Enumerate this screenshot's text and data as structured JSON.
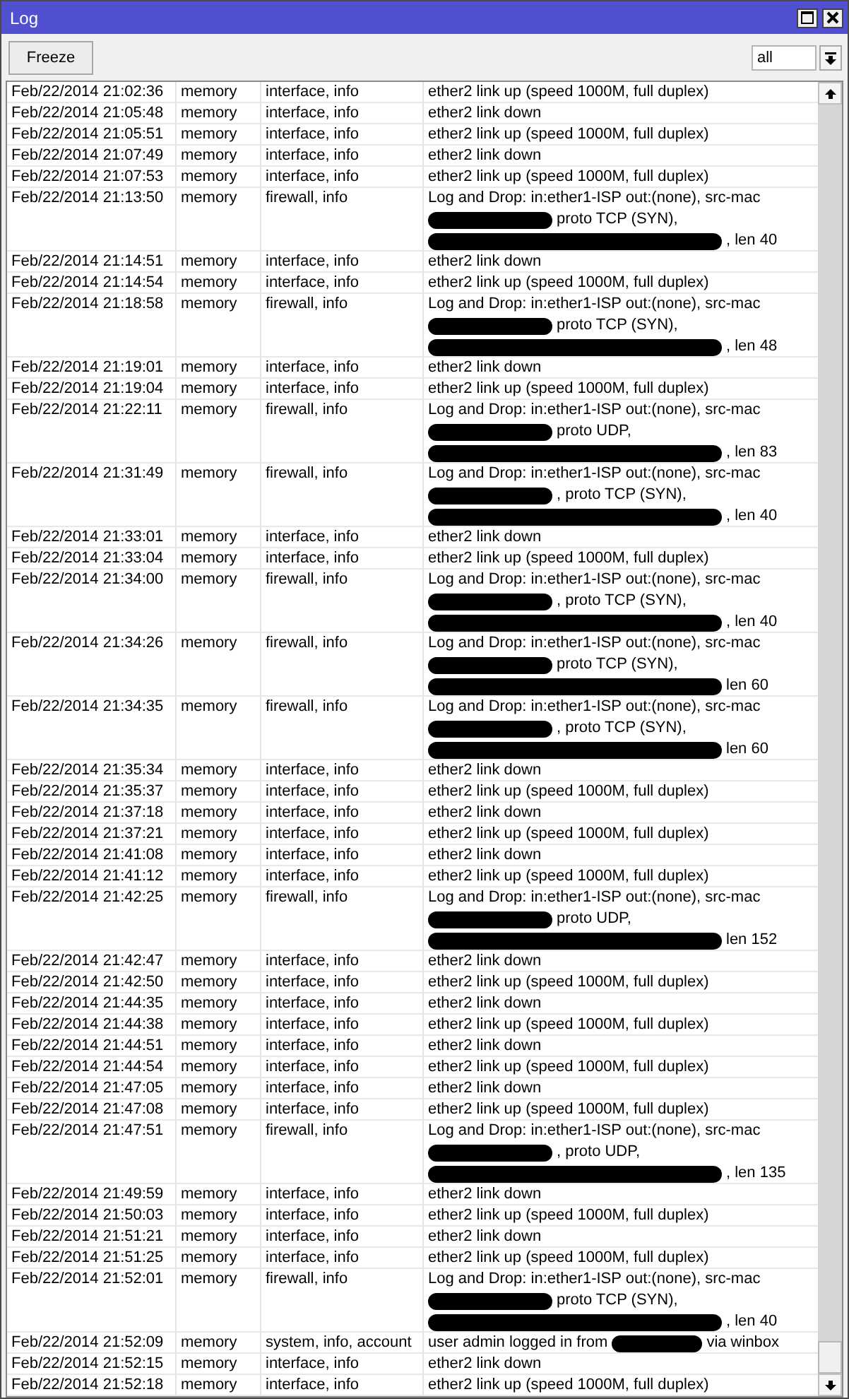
{
  "window": {
    "title": "Log"
  },
  "toolbar": {
    "freeze_button": "Freeze",
    "filter": {
      "value": "all"
    }
  },
  "log": {
    "rows": [
      {
        "column_1": "Feb/22/2014 21:02:36",
        "column_2": "memory",
        "column_3": "interface, info",
        "column_4": [
          [
            {
              "kind": "text",
              "text": "ether2 link up (speed 1000M, full duplex)"
            }
          ]
        ]
      },
      {
        "column_1": "Feb/22/2014 21:05:48",
        "column_2": "memory",
        "column_3": "interface, info",
        "column_4": [
          [
            {
              "kind": "text",
              "text": "ether2 link down"
            }
          ]
        ]
      },
      {
        "column_1": "Feb/22/2014 21:05:51",
        "column_2": "memory",
        "column_3": "interface, info",
        "column_4": [
          [
            {
              "kind": "text",
              "text": "ether2 link up (speed 1000M, full duplex)"
            }
          ]
        ]
      },
      {
        "column_1": "Feb/22/2014 21:07:49",
        "column_2": "memory",
        "column_3": "interface, info",
        "column_4": [
          [
            {
              "kind": "text",
              "text": "ether2 link down"
            }
          ]
        ]
      },
      {
        "column_1": "Feb/22/2014 21:07:53",
        "column_2": "memory",
        "column_3": "interface, info",
        "column_4": [
          [
            {
              "kind": "text",
              "text": "ether2 link up (speed 1000M, full duplex)"
            }
          ]
        ]
      },
      {
        "column_1": "Feb/22/2014 21:13:50",
        "column_2": "memory",
        "column_3": "firewall, info",
        "column_4": [
          [
            {
              "kind": "text",
              "text": "Log and Drop: in:ether1-ISP out:(none), src-mac"
            }
          ],
          [
            {
              "kind": "redaction"
            },
            {
              "kind": "text",
              "text": "proto TCP (SYN),"
            }
          ],
          [
            {
              "kind": "redaction"
            },
            {
              "kind": "text",
              "text": ", len 40"
            }
          ]
        ]
      },
      {
        "column_1": "Feb/22/2014 21:14:51",
        "column_2": "memory",
        "column_3": "interface, info",
        "column_4": [
          [
            {
              "kind": "text",
              "text": "ether2 link down"
            }
          ]
        ]
      },
      {
        "column_1": "Feb/22/2014 21:14:54",
        "column_2": "memory",
        "column_3": "interface, info",
        "column_4": [
          [
            {
              "kind": "text",
              "text": "ether2 link up (speed 1000M, full duplex)"
            }
          ]
        ]
      },
      {
        "column_1": "Feb/22/2014 21:18:58",
        "column_2": "memory",
        "column_3": "firewall, info",
        "column_4": [
          [
            {
              "kind": "text",
              "text": "Log and Drop: in:ether1-ISP out:(none), src-mac"
            }
          ],
          [
            {
              "kind": "redaction"
            },
            {
              "kind": "text",
              "text": "proto TCP (SYN),"
            }
          ],
          [
            {
              "kind": "redaction"
            },
            {
              "kind": "text",
              "text": ", len 48"
            }
          ]
        ]
      },
      {
        "column_1": "Feb/22/2014 21:19:01",
        "column_2": "memory",
        "column_3": "interface, info",
        "column_4": [
          [
            {
              "kind": "text",
              "text": "ether2 link down"
            }
          ]
        ]
      },
      {
        "column_1": "Feb/22/2014 21:19:04",
        "column_2": "memory",
        "column_3": "interface, info",
        "column_4": [
          [
            {
              "kind": "text",
              "text": "ether2 link up (speed 1000M, full duplex)"
            }
          ]
        ]
      },
      {
        "column_1": "Feb/22/2014 21:22:11",
        "column_2": "memory",
        "column_3": "firewall, info",
        "column_4": [
          [
            {
              "kind": "text",
              "text": "Log and Drop: in:ether1-ISP out:(none), src-mac"
            }
          ],
          [
            {
              "kind": "redaction"
            },
            {
              "kind": "text",
              "text": "proto UDP,"
            }
          ],
          [
            {
              "kind": "redaction"
            },
            {
              "kind": "text",
              "text": ", len 83"
            }
          ]
        ]
      },
      {
        "column_1": "Feb/22/2014 21:31:49",
        "column_2": "memory",
        "column_3": "firewall, info",
        "column_4": [
          [
            {
              "kind": "text",
              "text": "Log and Drop: in:ether1-ISP out:(none), src-mac"
            }
          ],
          [
            {
              "kind": "redaction"
            },
            {
              "kind": "text",
              "text": ", proto TCP (SYN),"
            }
          ],
          [
            {
              "kind": "redaction"
            },
            {
              "kind": "text",
              "text": ", len 40"
            }
          ]
        ]
      },
      {
        "column_1": "Feb/22/2014 21:33:01",
        "column_2": "memory",
        "column_3": "interface, info",
        "column_4": [
          [
            {
              "kind": "text",
              "text": "ether2 link down"
            }
          ]
        ]
      },
      {
        "column_1": "Feb/22/2014 21:33:04",
        "column_2": "memory",
        "column_3": "interface, info",
        "column_4": [
          [
            {
              "kind": "text",
              "text": "ether2 link up (speed 1000M, full duplex)"
            }
          ]
        ]
      },
      {
        "column_1": "Feb/22/2014 21:34:00",
        "column_2": "memory",
        "column_3": "firewall, info",
        "column_4": [
          [
            {
              "kind": "text",
              "text": "Log and Drop: in:ether1-ISP out:(none), src-mac"
            }
          ],
          [
            {
              "kind": "redaction"
            },
            {
              "kind": "text",
              "text": ", proto TCP (SYN),"
            }
          ],
          [
            {
              "kind": "redaction"
            },
            {
              "kind": "text",
              "text": ", len 40"
            }
          ]
        ]
      },
      {
        "column_1": "Feb/22/2014 21:34:26",
        "column_2": "memory",
        "column_3": "firewall, info",
        "column_4": [
          [
            {
              "kind": "text",
              "text": "Log and Drop: in:ether1-ISP out:(none), src-mac"
            }
          ],
          [
            {
              "kind": "redaction"
            },
            {
              "kind": "text",
              "text": "proto TCP (SYN),"
            }
          ],
          [
            {
              "kind": "redaction"
            },
            {
              "kind": "text",
              "text": "len 60"
            }
          ]
        ]
      },
      {
        "column_1": "Feb/22/2014 21:34:35",
        "column_2": "memory",
        "column_3": "firewall, info",
        "column_4": [
          [
            {
              "kind": "text",
              "text": "Log and Drop: in:ether1-ISP out:(none), src-mac"
            }
          ],
          [
            {
              "kind": "redaction"
            },
            {
              "kind": "text",
              "text": ", proto TCP (SYN),"
            }
          ],
          [
            {
              "kind": "redaction"
            },
            {
              "kind": "text",
              "text": "len 60"
            }
          ]
        ]
      },
      {
        "column_1": "Feb/22/2014 21:35:34",
        "column_2": "memory",
        "column_3": "interface, info",
        "column_4": [
          [
            {
              "kind": "text",
              "text": "ether2 link down"
            }
          ]
        ]
      },
      {
        "column_1": "Feb/22/2014 21:35:37",
        "column_2": "memory",
        "column_3": "interface, info",
        "column_4": [
          [
            {
              "kind": "text",
              "text": "ether2 link up (speed 1000M, full duplex)"
            }
          ]
        ]
      },
      {
        "column_1": "Feb/22/2014 21:37:18",
        "column_2": "memory",
        "column_3": "interface, info",
        "column_4": [
          [
            {
              "kind": "text",
              "text": "ether2 link down"
            }
          ]
        ]
      },
      {
        "column_1": "Feb/22/2014 21:37:21",
        "column_2": "memory",
        "column_3": "interface, info",
        "column_4": [
          [
            {
              "kind": "text",
              "text": "ether2 link up (speed 1000M, full duplex)"
            }
          ]
        ]
      },
      {
        "column_1": "Feb/22/2014 21:41:08",
        "column_2": "memory",
        "column_3": "interface, info",
        "column_4": [
          [
            {
              "kind": "text",
              "text": "ether2 link down"
            }
          ]
        ]
      },
      {
        "column_1": "Feb/22/2014 21:41:12",
        "column_2": "memory",
        "column_3": "interface, info",
        "column_4": [
          [
            {
              "kind": "text",
              "text": "ether2 link up (speed 1000M, full duplex)"
            }
          ]
        ]
      },
      {
        "column_1": "Feb/22/2014 21:42:25",
        "column_2": "memory",
        "column_3": "firewall, info",
        "column_4": [
          [
            {
              "kind": "text",
              "text": "Log and Drop: in:ether1-ISP out:(none), src-mac"
            }
          ],
          [
            {
              "kind": "redaction"
            },
            {
              "kind": "text",
              "text": "proto UDP,"
            }
          ],
          [
            {
              "kind": "redaction"
            },
            {
              "kind": "text",
              "text": "len 152"
            }
          ]
        ]
      },
      {
        "column_1": "Feb/22/2014 21:42:47",
        "column_2": "memory",
        "column_3": "interface, info",
        "column_4": [
          [
            {
              "kind": "text",
              "text": "ether2 link down"
            }
          ]
        ]
      },
      {
        "column_1": "Feb/22/2014 21:42:50",
        "column_2": "memory",
        "column_3": "interface, info",
        "column_4": [
          [
            {
              "kind": "text",
              "text": "ether2 link up (speed 1000M, full duplex)"
            }
          ]
        ]
      },
      {
        "column_1": "Feb/22/2014 21:44:35",
        "column_2": "memory",
        "column_3": "interface, info",
        "column_4": [
          [
            {
              "kind": "text",
              "text": "ether2 link down"
            }
          ]
        ]
      },
      {
        "column_1": "Feb/22/2014 21:44:38",
        "column_2": "memory",
        "column_3": "interface, info",
        "column_4": [
          [
            {
              "kind": "text",
              "text": "ether2 link up (speed 1000M, full duplex)"
            }
          ]
        ]
      },
      {
        "column_1": "Feb/22/2014 21:44:51",
        "column_2": "memory",
        "column_3": "interface, info",
        "column_4": [
          [
            {
              "kind": "text",
              "text": "ether2 link down"
            }
          ]
        ]
      },
      {
        "column_1": "Feb/22/2014 21:44:54",
        "column_2": "memory",
        "column_3": "interface, info",
        "column_4": [
          [
            {
              "kind": "text",
              "text": "ether2 link up (speed 1000M, full duplex)"
            }
          ]
        ]
      },
      {
        "column_1": "Feb/22/2014 21:47:05",
        "column_2": "memory",
        "column_3": "interface, info",
        "column_4": [
          [
            {
              "kind": "text",
              "text": "ether2 link down"
            }
          ]
        ]
      },
      {
        "column_1": "Feb/22/2014 21:47:08",
        "column_2": "memory",
        "column_3": "interface, info",
        "column_4": [
          [
            {
              "kind": "text",
              "text": "ether2 link up (speed 1000M, full duplex)"
            }
          ]
        ]
      },
      {
        "column_1": "Feb/22/2014 21:47:51",
        "column_2": "memory",
        "column_3": "firewall, info",
        "column_4": [
          [
            {
              "kind": "text",
              "text": "Log and Drop: in:ether1-ISP out:(none), src-mac"
            }
          ],
          [
            {
              "kind": "redaction"
            },
            {
              "kind": "text",
              "text": ", proto UDP,"
            }
          ],
          [
            {
              "kind": "redaction"
            },
            {
              "kind": "text",
              "text": ", len 135"
            }
          ]
        ]
      },
      {
        "column_1": "Feb/22/2014 21:49:59",
        "column_2": "memory",
        "column_3": "interface, info",
        "column_4": [
          [
            {
              "kind": "text",
              "text": "ether2 link down"
            }
          ]
        ]
      },
      {
        "column_1": "Feb/22/2014 21:50:03",
        "column_2": "memory",
        "column_3": "interface, info",
        "column_4": [
          [
            {
              "kind": "text",
              "text": "ether2 link up (speed 1000M, full duplex)"
            }
          ]
        ]
      },
      {
        "column_1": "Feb/22/2014 21:51:21",
        "column_2": "memory",
        "column_3": "interface, info",
        "column_4": [
          [
            {
              "kind": "text",
              "text": "ether2 link down"
            }
          ]
        ]
      },
      {
        "column_1": "Feb/22/2014 21:51:25",
        "column_2": "memory",
        "column_3": "interface, info",
        "column_4": [
          [
            {
              "kind": "text",
              "text": "ether2 link up (speed 1000M, full duplex)"
            }
          ]
        ]
      },
      {
        "column_1": "Feb/22/2014 21:52:01",
        "column_2": "memory",
        "column_3": "firewall, info",
        "column_4": [
          [
            {
              "kind": "text",
              "text": "Log and Drop: in:ether1-ISP out:(none), src-mac"
            }
          ],
          [
            {
              "kind": "redaction"
            },
            {
              "kind": "text",
              "text": "proto TCP (SYN),"
            }
          ],
          [
            {
              "kind": "redaction"
            },
            {
              "kind": "text",
              "text": ", len 40"
            }
          ]
        ]
      },
      {
        "column_1": "Feb/22/2014 21:52:09",
        "column_2": "memory",
        "column_3": "system, info, account",
        "column_4": [
          [
            {
              "kind": "text",
              "text": "user admin logged in from"
            },
            {
              "kind": "redaction"
            },
            {
              "kind": "text",
              "text": "via winbox"
            }
          ]
        ]
      },
      {
        "column_1": "Feb/22/2014 21:52:15",
        "column_2": "memory",
        "column_3": "interface, info",
        "column_4": [
          [
            {
              "kind": "text",
              "text": "ether2 link down"
            }
          ]
        ]
      },
      {
        "column_1": "Feb/22/2014 21:52:18",
        "column_2": "memory",
        "column_3": "interface, info",
        "column_4": [
          [
            {
              "kind": "text",
              "text": "ether2 link up (speed 1000M, full duplex)"
            }
          ]
        ]
      }
    ]
  }
}
